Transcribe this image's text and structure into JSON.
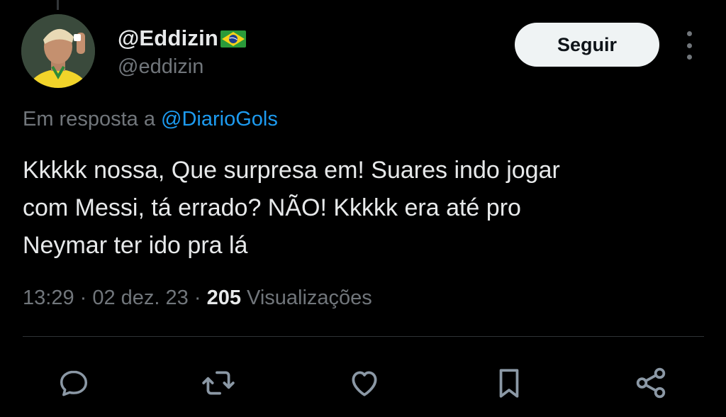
{
  "author": {
    "display_name": "@Eddizin",
    "flag_emoji": "brazil-flag",
    "handle": "@eddizin",
    "avatar": "avatar-photo"
  },
  "follow_label": "Seguir",
  "reply_context": {
    "prefix": "Em resposta a",
    "mention": "@DiarioGols"
  },
  "tweet_text": "Kkkkk nossa, Que surpresa em! Suares indo jogar\ncom Messi, tá errado? NÃO! Kkkkk era até pro\nNeymar ter ido pra lá",
  "meta": {
    "time_date": "13:29 · 02 dez. 23 ·",
    "view_count": "205",
    "view_label": "Visualizações"
  },
  "actions": [
    "reply-icon",
    "retweet-icon",
    "like-icon",
    "bookmark-icon",
    "share-icon"
  ],
  "colors": {
    "background": "#000000",
    "text": "#e7e9ea",
    "secondary": "#71767b",
    "link": "#1d9bf0",
    "button_bg": "#eff3f4"
  }
}
